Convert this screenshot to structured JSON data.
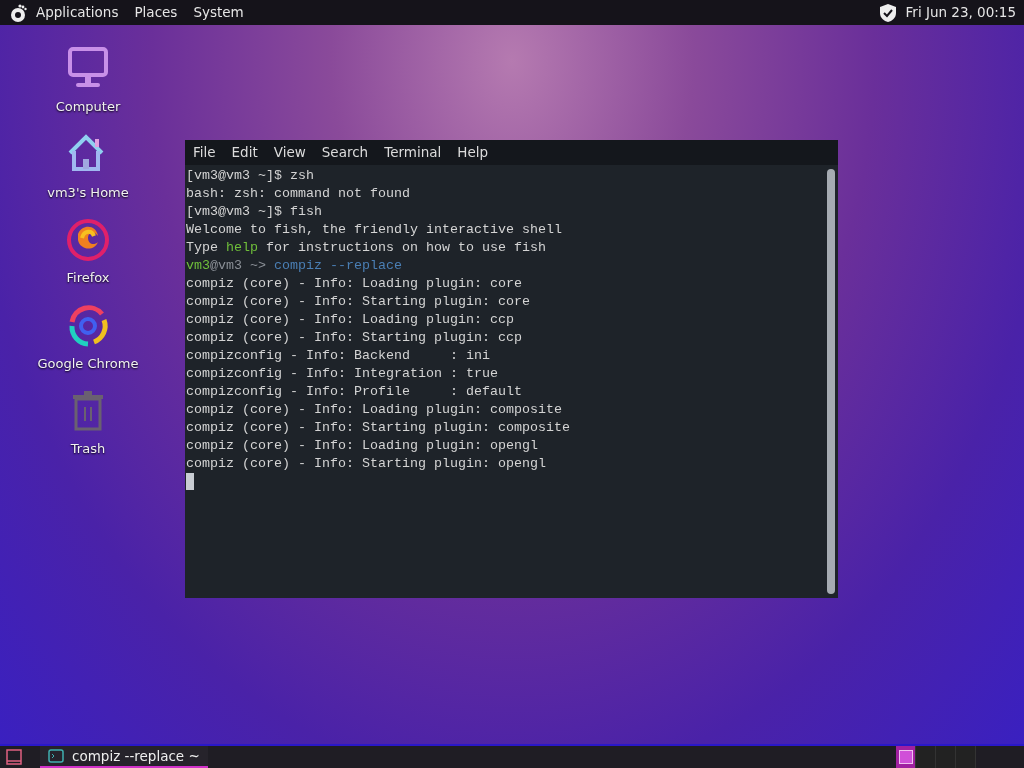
{
  "top_panel": {
    "menus": [
      "Applications",
      "Places",
      "System"
    ],
    "clock": "Fri Jun 23, 00:15"
  },
  "desktop_icons": [
    {
      "label": "Computer",
      "kind": "computer"
    },
    {
      "label": "vm3's Home",
      "kind": "home"
    },
    {
      "label": "Firefox",
      "kind": "firefox"
    },
    {
      "label": "Google Chrome",
      "kind": "chrome"
    },
    {
      "label": "Trash",
      "kind": "trash"
    }
  ],
  "terminal": {
    "menu": [
      "File",
      "Edit",
      "View",
      "Search",
      "Terminal",
      "Help"
    ],
    "lines": [
      [
        {
          "text": "[vm3@vm3 ~]$ zsh",
          "kind": "plain"
        }
      ],
      [
        {
          "text": "bash: zsh: command not found",
          "kind": "plain"
        }
      ],
      [
        {
          "text": "[vm3@vm3 ~]$ fish",
          "kind": "plain"
        }
      ],
      [
        {
          "text": "Welcome to fish, the friendly interactive shell",
          "kind": "plain"
        }
      ],
      [
        {
          "text": "Type ",
          "kind": "plain"
        },
        {
          "text": "help",
          "kind": "keyword"
        },
        {
          "text": " for instructions on how to use fish",
          "kind": "plain"
        }
      ],
      [
        {
          "text": "vm3",
          "kind": "user"
        },
        {
          "text": "@vm3 ~> ",
          "kind": "dim"
        },
        {
          "text": "compiz --replace",
          "kind": "command"
        }
      ],
      [
        {
          "text": "compiz (core) - Info: Loading plugin: core",
          "kind": "plain"
        }
      ],
      [
        {
          "text": "compiz (core) - Info: Starting plugin: core",
          "kind": "plain"
        }
      ],
      [
        {
          "text": "compiz (core) - Info: Loading plugin: ccp",
          "kind": "plain"
        }
      ],
      [
        {
          "text": "compiz (core) - Info: Starting plugin: ccp",
          "kind": "plain"
        }
      ],
      [
        {
          "text": "compizconfig - Info: Backend     : ini",
          "kind": "plain"
        }
      ],
      [
        {
          "text": "compizconfig - Info: Integration : true",
          "kind": "plain"
        }
      ],
      [
        {
          "text": "compizconfig - Info: Profile     : default",
          "kind": "plain"
        }
      ],
      [
        {
          "text": "compiz (core) - Info: Loading plugin: composite",
          "kind": "plain"
        }
      ],
      [
        {
          "text": "compiz (core) - Info: Starting plugin: composite",
          "kind": "plain"
        }
      ],
      [
        {
          "text": "compiz (core) - Info: Loading plugin: opengl",
          "kind": "plain"
        }
      ],
      [
        {
          "text": "compiz (core) - Info: Starting plugin: opengl",
          "kind": "plain"
        }
      ]
    ]
  },
  "taskbar": {
    "tasks": [
      {
        "label": "compiz --replace ~",
        "selected": true
      }
    ],
    "workspaces": [
      {
        "selected": true
      },
      {
        "selected": false
      },
      {
        "selected": false
      },
      {
        "selected": false
      }
    ]
  }
}
